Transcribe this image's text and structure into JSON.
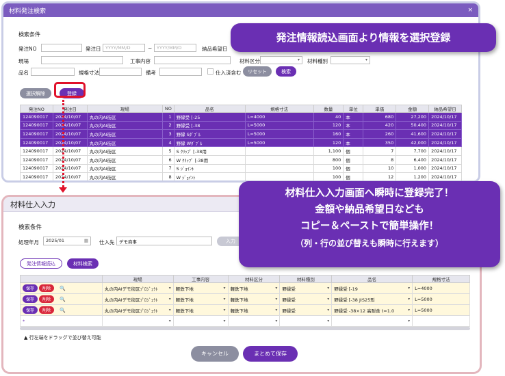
{
  "top": {
    "title": "材料発注検索",
    "close": "×",
    "section": "検索条件",
    "labels": {
      "order_no": "発注NO",
      "order_date": "発注日",
      "tilde": "~",
      "desired_date": "納品希望日",
      "site": "現場",
      "work": "工事内容",
      "material_cat": "材料区分",
      "material_type": "材料種別",
      "item": "品名",
      "spec": "規格寸法",
      "remarks": "備考",
      "received": "仕入済含む"
    },
    "placeholders": {
      "date1": "YYYY/MM/D",
      "date2": "YYYY/MM/D"
    },
    "buttons": {
      "reset": "リセット",
      "search": "検索",
      "deselect": "選択解除",
      "register": "登録"
    },
    "columns": [
      "発注NO",
      "発注日",
      "現場",
      "NO",
      "品名",
      "規格寸法",
      "数量",
      "単位",
      "単価",
      "金額",
      "納品希望日"
    ],
    "rows": [
      [
        "124090017",
        "2024/10/07",
        "丸の内AI街区",
        "1",
        "野縁受 [-25",
        "L=4000",
        "40",
        "本",
        "680",
        "27,200",
        "2024/10/17"
      ],
      [
        "124090017",
        "2024/10/07",
        "丸の内AI街区",
        "2",
        "野縁受 [-38",
        "L=5000",
        "120",
        "本",
        "420",
        "50,400",
        "2024/10/17"
      ],
      [
        "124090017",
        "2024/10/07",
        "丸の内AI街区",
        "3",
        "野縁 Sﾀﾞﾌﾞﾙ",
        "L=5000",
        "160",
        "本",
        "260",
        "41,600",
        "2024/10/17"
      ],
      [
        "124090017",
        "2024/10/07",
        "丸の内AI街区",
        "4",
        "野縁 Wﾀﾞﾌﾞﾙ",
        "L=5000",
        "120",
        "本",
        "350",
        "42,000",
        "2024/10/17"
      ],
      [
        "124090017",
        "2024/10/07",
        "丸の内AI街区",
        "5",
        "S ｸﾘｯﾌﾟ [-38用",
        "",
        "1,100",
        "個",
        "7",
        "7,700",
        "2024/10/17"
      ],
      [
        "124090017",
        "2024/10/07",
        "丸の内AI街区",
        "6",
        "W ｸﾘｯﾌﾟ [-38用",
        "",
        "800",
        "個",
        "8",
        "6,400",
        "2024/10/17"
      ],
      [
        "124090017",
        "2024/10/07",
        "丸の内AI街区",
        "7",
        "S ｼﾞｮｲﾝﾄ",
        "",
        "100",
        "個",
        "10",
        "1,000",
        "2024/10/17"
      ],
      [
        "124090017",
        "2024/10/07",
        "丸の内AI街区",
        "8",
        "W ｼﾞｮｲﾝﾄ",
        "",
        "100",
        "個",
        "12",
        "1,200",
        "2024/10/17"
      ]
    ]
  },
  "bottom": {
    "title": "材料仕入入力",
    "section": "検索条件",
    "labels": {
      "month": "処理年月",
      "supplier": "仕入先",
      "hint": "▲ 行左端をドラッグで並び替え可能"
    },
    "values": {
      "month": "2025/01",
      "supplier": "デモ商事"
    },
    "buttons": {
      "load": "発注情報読込",
      "search": "材料検索",
      "cancel": "キャンセル",
      "save_all": "まとめて保存",
      "input": "入力",
      "save": "保存",
      "delete": "削除"
    },
    "columns": [
      "",
      "現場",
      "工事内容",
      "材料区分",
      "材料種別",
      "品名",
      "規格寸法"
    ],
    "rows": [
      [
        "丸の内AIデモ街区ﾌﾟﾛｼﾞｪｸﾄ",
        "軽鉄下地",
        "軽鉄下地",
        "野縁受",
        "野縁受 [-19",
        "L=4000"
      ],
      [
        "丸の内AIデモ街区ﾌﾟﾛｼﾞｪｸﾄ",
        "軽鉄下地",
        "軽鉄下地",
        "野縁受",
        "野縁受 [-38 JIS25形",
        "L=5000"
      ],
      [
        "丸の内AIデモ街区ﾌﾟﾛｼﾞｪｸﾄ",
        "軽鉄下地",
        "軽鉄下地",
        "野縁受",
        "野縁受 -38×12 高耐食 t=1.0",
        "L=5000"
      ]
    ],
    "new_row_marker": "*"
  },
  "callouts": {
    "first": "発注情報読込画面より情報を選択登録",
    "second_lines": [
      "材料仕入入力画面へ瞬時に登録完了！",
      "金額や納品希望日なども",
      "コピー＆ペーストで簡単操作！"
    ],
    "second_small": "（列・行の並び替えも瞬時に行えます）"
  },
  "colors": {
    "accent": "#6a2fb3",
    "highlight": "#e0112a",
    "delete": "#d9263a"
  },
  "icons": {
    "search": "search-icon",
    "calendar": "calendar-icon"
  }
}
